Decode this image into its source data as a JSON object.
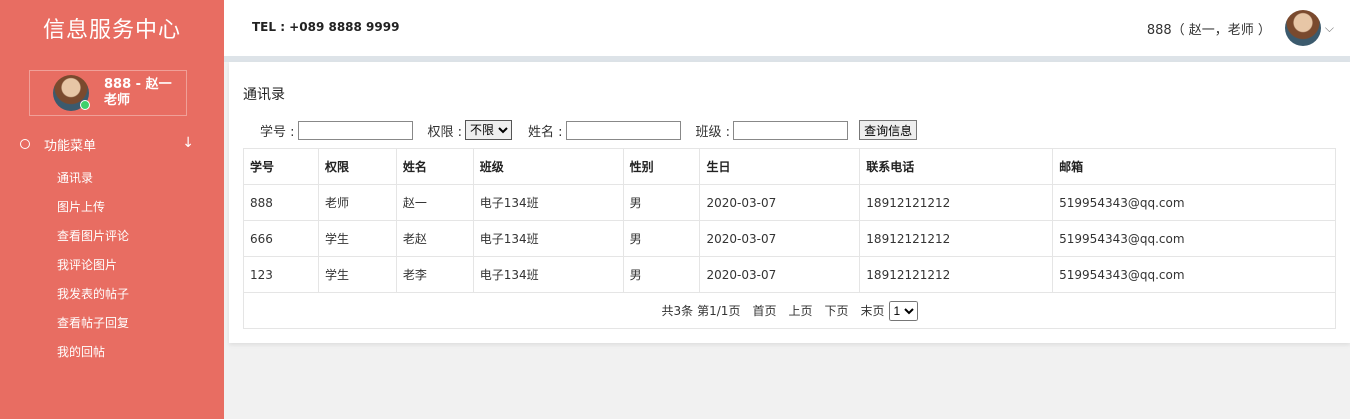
{
  "sidebar": {
    "brand": "信息服务中心",
    "user": "888 - 赵一\n老师",
    "menu_title": "功能菜单",
    "menu_items": [
      "通讯录",
      "图片上传",
      "查看图片评论",
      "我评论图片",
      "我发表的帖子",
      "查看帖子回复",
      "我的回帖"
    ]
  },
  "header": {
    "tel": "TEL : +089 8888 9999",
    "user_info": "888（ 赵一，老师 ）"
  },
  "main": {
    "title": "通讯录",
    "search": {
      "id_label": "学号 :",
      "role_label": "权限 :",
      "role_value": "不限",
      "name_label": "姓名 :",
      "class_label": "班级 :",
      "query_button": "查询信息"
    },
    "table": {
      "headers": [
        "学号",
        "权限",
        "姓名",
        "班级",
        "性别",
        "生日",
        "联系电话",
        "邮箱"
      ],
      "rows": [
        [
          "888",
          "老师",
          "赵一",
          "电子134班",
          "男",
          "2020-03-07",
          "18912121212",
          "519954343@qq.com"
        ],
        [
          "666",
          "学生",
          "老赵",
          "电子134班",
          "男",
          "2020-03-07",
          "18912121212",
          "519954343@qq.com"
        ],
        [
          "123",
          "学生",
          "老李",
          "电子134班",
          "男",
          "2020-03-07",
          "18912121212",
          "519954343@qq.com"
        ]
      ]
    },
    "pager": {
      "total": "共3条",
      "page": "第1/1页",
      "first": "首页",
      "prev": "上页",
      "next": "下页",
      "last": "末页",
      "page_select": "1"
    }
  }
}
